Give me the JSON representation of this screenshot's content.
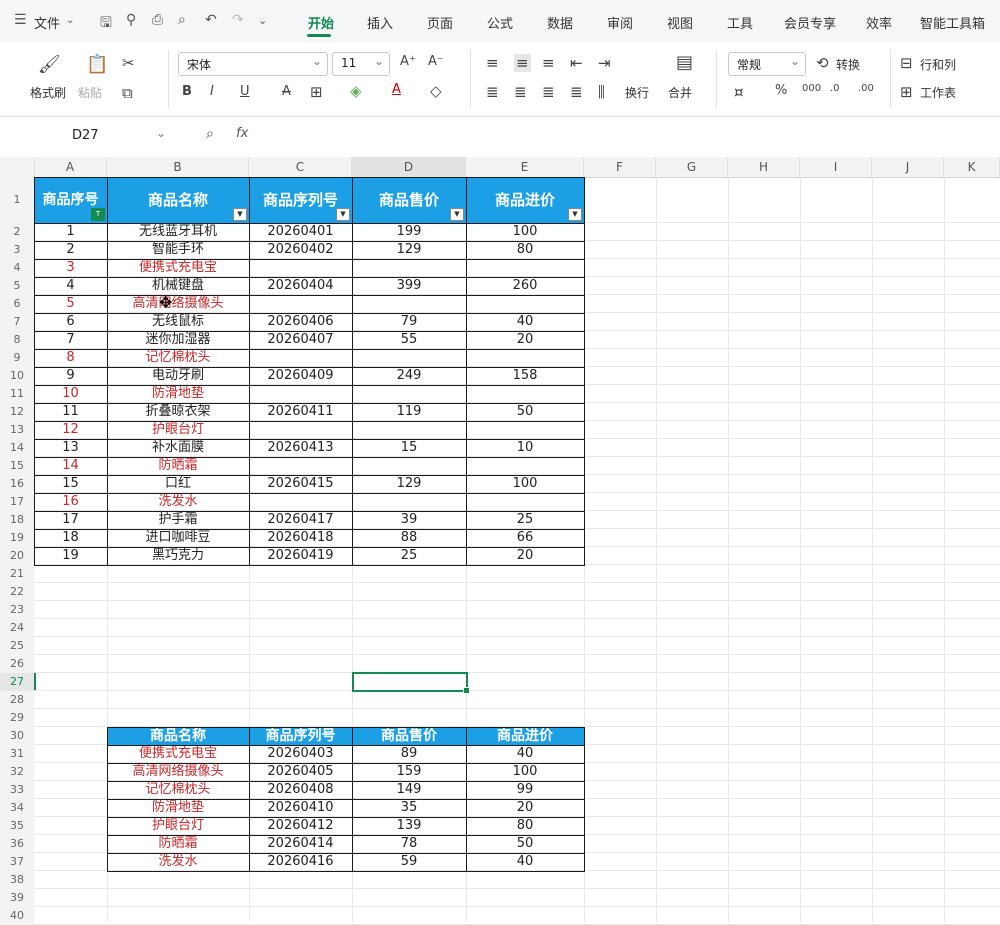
{
  "menu": {
    "file": "文件",
    "tabs": [
      "开始",
      "插入",
      "页面",
      "公式",
      "数据",
      "审阅",
      "视图",
      "工具",
      "会员专享",
      "效率",
      "智能工具箱"
    ]
  },
  "ribbon": {
    "format_painter": "格式刷",
    "paste": "粘贴",
    "font_name": "宋体",
    "font_size": "11",
    "number_format": "常规",
    "convert": "转换",
    "rows_cols": "行和列",
    "wrap": "换行",
    "merge": "合并",
    "worksheet": "工作表"
  },
  "formula_bar": {
    "cell_ref": "D27",
    "fx": "fx",
    "content": ""
  },
  "sheet": {
    "columns": [
      "A",
      "B",
      "C",
      "D",
      "E",
      "F",
      "G",
      "H",
      "I",
      "J",
      "K"
    ],
    "selected_column": "D",
    "selected_row": "27",
    "row_numbers": [
      "1",
      "2",
      "3",
      "4",
      "5",
      "6",
      "7",
      "8",
      "9",
      "10",
      "11",
      "12",
      "13",
      "14",
      "15",
      "16",
      "17",
      "18",
      "19",
      "20",
      "21",
      "22",
      "23",
      "24",
      "25",
      "26",
      "27",
      "28",
      "29",
      "30",
      "31",
      "32",
      "33",
      "34",
      "35",
      "36",
      "37",
      "38",
      "39",
      "40"
    ]
  },
  "table1": {
    "headers": [
      "商品序号",
      "商品名称",
      "商品序列号",
      "商品售价",
      "商品进价"
    ],
    "rows": [
      {
        "cells": [
          "1",
          "无线蓝牙耳机",
          "20260401",
          "199",
          "100"
        ],
        "red": false
      },
      {
        "cells": [
          "2",
          "智能手环",
          "20260402",
          "129",
          "80"
        ],
        "red": false
      },
      {
        "cells": [
          "3",
          "便携式充电宝",
          "",
          "",
          ""
        ],
        "red": true
      },
      {
        "cells": [
          "4",
          "机械键盘",
          "20260404",
          "399",
          "260"
        ],
        "red": false
      },
      {
        "cells": [
          "5",
          "高清网络摄像头",
          "",
          "",
          ""
        ],
        "red": true
      },
      {
        "cells": [
          "6",
          "无线鼠标",
          "20260406",
          "79",
          "40"
        ],
        "red": false
      },
      {
        "cells": [
          "7",
          "迷你加湿器",
          "20260407",
          "55",
          "20"
        ],
        "red": false
      },
      {
        "cells": [
          "8",
          "记忆棉枕头",
          "",
          "",
          ""
        ],
        "red": true
      },
      {
        "cells": [
          "9",
          "电动牙刷",
          "20260409",
          "249",
          "158"
        ],
        "red": false
      },
      {
        "cells": [
          "10",
          "防滑地垫",
          "",
          "",
          ""
        ],
        "red": true
      },
      {
        "cells": [
          "11",
          "折叠晾衣架",
          "20260411",
          "119",
          "50"
        ],
        "red": false
      },
      {
        "cells": [
          "12",
          "护眼台灯",
          "",
          "",
          ""
        ],
        "red": true
      },
      {
        "cells": [
          "13",
          "补水面膜",
          "20260413",
          "15",
          "10"
        ],
        "red": false
      },
      {
        "cells": [
          "14",
          "防晒霜",
          "",
          "",
          ""
        ],
        "red": true
      },
      {
        "cells": [
          "15",
          "口红",
          "20260415",
          "129",
          "100"
        ],
        "red": false
      },
      {
        "cells": [
          "16",
          "洗发水",
          "",
          "",
          ""
        ],
        "red": true
      },
      {
        "cells": [
          "17",
          "护手霜",
          "20260417",
          "39",
          "25"
        ],
        "red": false
      },
      {
        "cells": [
          "18",
          "进口咖啡豆",
          "20260418",
          "88",
          "66"
        ],
        "red": false
      },
      {
        "cells": [
          "19",
          "黑巧克力",
          "20260419",
          "25",
          "20"
        ],
        "red": false
      }
    ]
  },
  "table2": {
    "headers": [
      "商品名称",
      "商品序列号",
      "商品售价",
      "商品进价"
    ],
    "rows": [
      [
        "便携式充电宝",
        "20260403",
        "89",
        "40"
      ],
      [
        "高清网络摄像头",
        "20260405",
        "159",
        "100"
      ],
      [
        "记忆棉枕头",
        "20260408",
        "149",
        "99"
      ],
      [
        "防滑地垫",
        "20260410",
        "35",
        "20"
      ],
      [
        "护眼台灯",
        "20260412",
        "139",
        "80"
      ],
      [
        "防晒霜",
        "20260414",
        "78",
        "50"
      ],
      [
        "洗发水",
        "20260416",
        "59",
        "40"
      ]
    ]
  },
  "colors": {
    "header_bg": "#1d9fe5",
    "red_text": "#c5282a",
    "accent": "#128a52"
  }
}
